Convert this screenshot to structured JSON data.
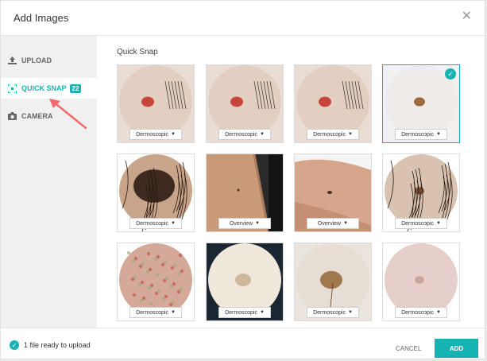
{
  "dialog": {
    "title": "Add Images",
    "close_icon": "close-icon"
  },
  "sidebar": {
    "items": [
      {
        "label": "UPLOAD",
        "icon": "upload-icon"
      },
      {
        "label": "QUICK SNAP",
        "icon": "quick-snap-icon",
        "badge": "22",
        "active": true
      },
      {
        "label": "CAMERA",
        "icon": "camera-icon"
      }
    ]
  },
  "content": {
    "section_title": "Quick Snap",
    "images": [
      {
        "type_label": "Dermoscopic",
        "selected": false,
        "style": "red-lesion"
      },
      {
        "type_label": "Dermoscopic",
        "selected": false,
        "style": "red-lesion"
      },
      {
        "type_label": "Dermoscopic",
        "selected": false,
        "style": "red-lesion"
      },
      {
        "type_label": "Dermoscopic",
        "selected": true,
        "style": "small-brown"
      },
      {
        "type_label": "Dermoscopic",
        "selected": false,
        "style": "dark-mole"
      },
      {
        "type_label": "Overview",
        "selected": false,
        "style": "arm"
      },
      {
        "type_label": "Overview",
        "selected": false,
        "style": "arm-close"
      },
      {
        "type_label": "Dermoscopic",
        "selected": false,
        "style": "hairy"
      },
      {
        "type_label": "Dermoscopic",
        "selected": false,
        "style": "red-mottled"
      },
      {
        "type_label": "Dermoscopic",
        "selected": false,
        "style": "pale-disc"
      },
      {
        "type_label": "Dermoscopic",
        "selected": false,
        "style": "brown-patch"
      },
      {
        "type_label": "Dermoscopic",
        "selected": false,
        "style": "pink"
      }
    ]
  },
  "footer": {
    "status": "1 file ready to upload",
    "cancel_label": "CANCEL",
    "add_label": "ADD"
  },
  "colors": {
    "accent": "#17b3b3",
    "sidebar_bg": "#f0f0f0"
  }
}
